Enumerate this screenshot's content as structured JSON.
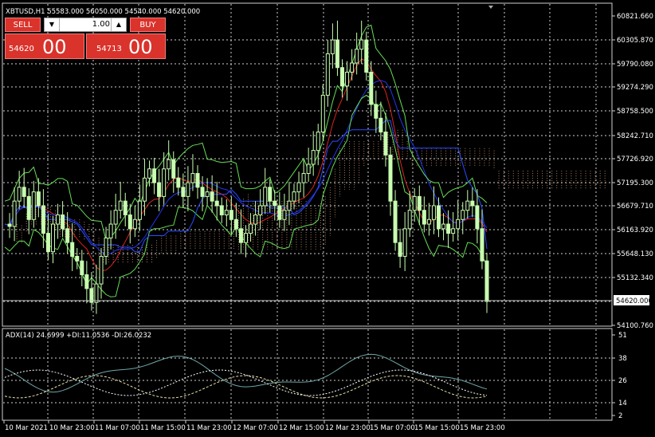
{
  "symbol_header": "XBTUSD,H1  55583.000 56050.000 54540.000 54620.000",
  "trade_panel": {
    "sell_label": "SELL",
    "buy_label": "BUY",
    "lot": "1.00",
    "sell_price_main": "54620",
    "sell_price_big": "00",
    "buy_price_main": "54713",
    "buy_price_big": "00",
    "button_color": "#d9332b"
  },
  "price_axis": [
    "60821.660",
    "60305.870",
    "59790.080",
    "59274.290",
    "58758.500",
    "58242.710",
    "57726.920",
    "57195.300",
    "56679.710",
    "56163.920",
    "55648.130",
    "55132.340",
    "54620.000",
    "54100.760"
  ],
  "current_price": "54620.000",
  "indicator_label": "ADX(14) 24.6999 +DI:11.0536 -DI:26.0232",
  "indicator_axis": [
    "51",
    "38",
    "26",
    "14",
    "2"
  ],
  "time_axis": [
    "10 Mar 2021",
    "10 Mar 23:00",
    "11 Mar 07:00",
    "11 Mar 15:00",
    "11 Mar 23:00",
    "12 Mar 07:00",
    "12 Mar 15:00",
    "12 Mar 23:00",
    "15 Mar 07:00",
    "15 Mar 15:00",
    "15 Mar 23:00"
  ],
  "colors": {
    "background": "#000000",
    "candles": "#c8ffb0",
    "bollinger": "#66dd55",
    "ma_red": "#dd2222",
    "ma_blue": "#2233ee",
    "cloud": "#e8a880",
    "grid": "#cfcfcf"
  }
}
